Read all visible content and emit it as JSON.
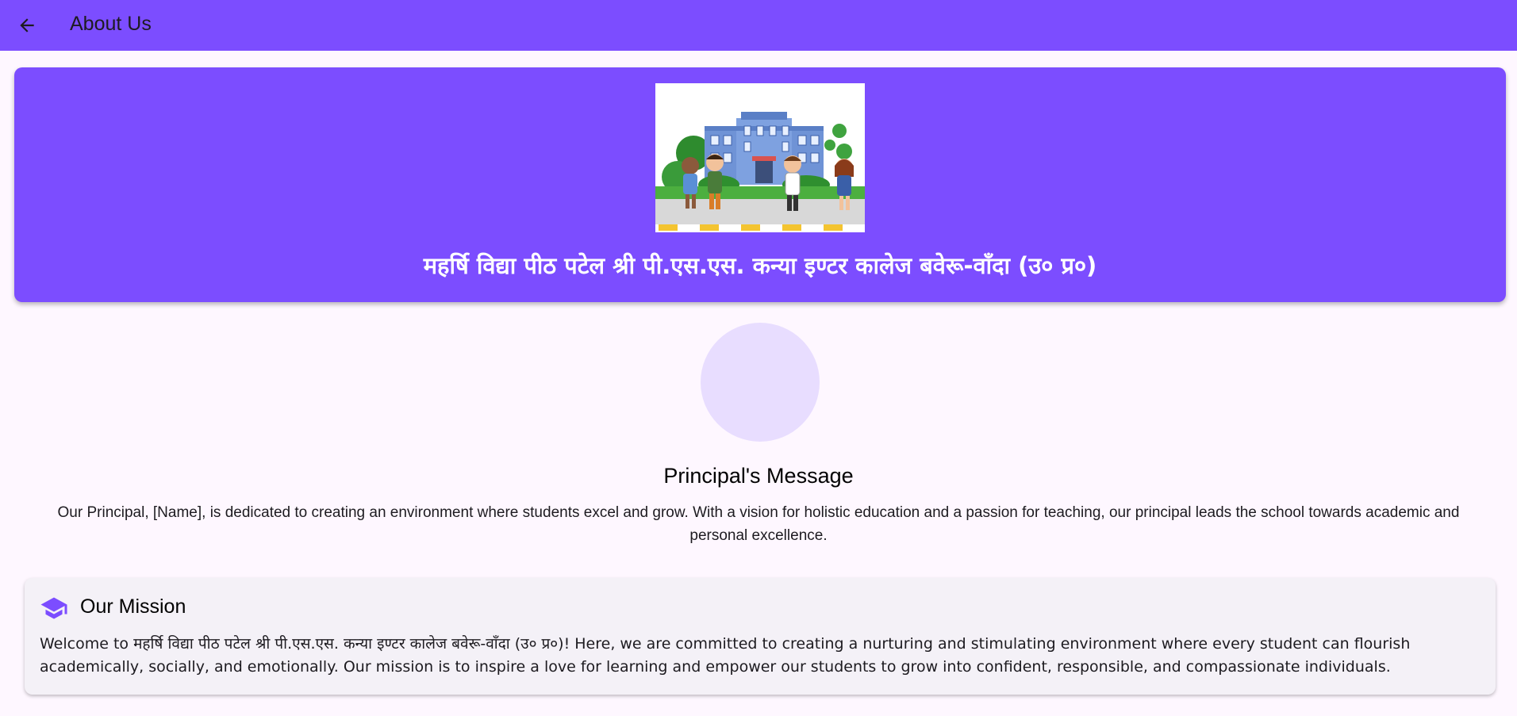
{
  "appbar": {
    "title": "About Us",
    "back_icon": "arrow-back-icon",
    "background": "#7c4dff"
  },
  "hero": {
    "image_alt": "school-building-illustration",
    "title": "महर्षि विद्या पीठ पटेल श्री पी.एस.एस. कन्या इण्टर कालेज बवेरू-वाँदा (उ० प्र०)",
    "background": "#7c4dff"
  },
  "principal": {
    "avatar_color": "#e8ddff",
    "heading": "Principal's Message",
    "message": "Our Principal, [Name], is dedicated to creating an environment where students excel and grow. With a vision for holistic education and a passion for teaching, our principal leads the school towards academic and personal excellence."
  },
  "mission": {
    "icon": "graduation-cap-icon",
    "title": "Our Mission",
    "text": "Welcome to महर्षि विद्या पीठ पटेल श्री पी.एस.एस. कन्या इण्टर कालेज बवेरू-वाँदा (उ० प्र०)! Here, we are committed to creating a nurturing and stimulating environment where every student can flourish academically, socially, and emotionally. Our mission is to inspire a love for learning and empower our students to grow into confident, responsible, and compassionate individuals."
  }
}
